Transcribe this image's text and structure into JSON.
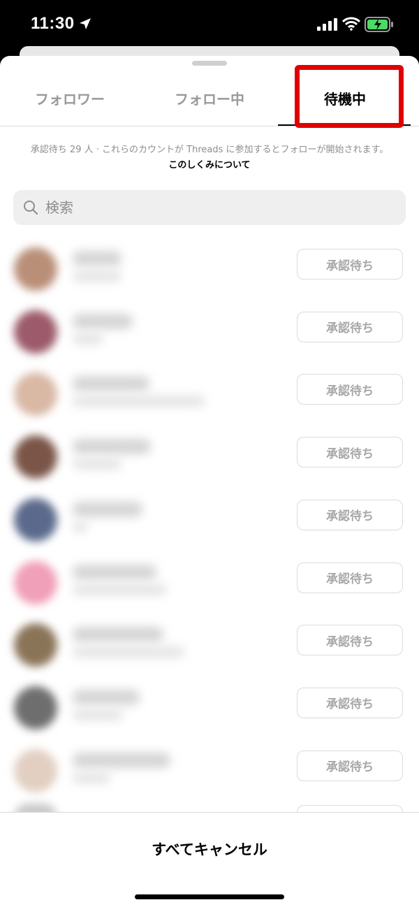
{
  "status_bar": {
    "time": "11:30"
  },
  "tabs": [
    {
      "label": "フォロワー",
      "active": false
    },
    {
      "label": "フォロー中",
      "active": false
    },
    {
      "label": "待機中",
      "active": true
    }
  ],
  "info": {
    "text": "承認待ち 29 人 · これらのカウントが Threads に参加するとフォローが開始されます。",
    "link": "このしくみについて"
  },
  "search": {
    "placeholder": "検索"
  },
  "rows": [
    {
      "avatar_color": "#b98f78",
      "button_label": "承認待ち"
    },
    {
      "avatar_color": "#9c5a6a",
      "button_label": "承認待ち"
    },
    {
      "avatar_color": "#d9b8a4",
      "button_label": "承認待ち"
    },
    {
      "avatar_color": "#7a5548",
      "button_label": "承認待ち"
    },
    {
      "avatar_color": "#5b6a8c",
      "button_label": "承認待ち"
    },
    {
      "avatar_color": "#f0a0b8",
      "button_label": "承認待ち"
    },
    {
      "avatar_color": "#8a7458",
      "button_label": "承認待ち"
    },
    {
      "avatar_color": "#6e6e6e",
      "button_label": "承認待ち"
    },
    {
      "avatar_color": "#e2cfc2",
      "button_label": "承認待ち"
    }
  ],
  "footer": {
    "cancel_all_label": "すべてキャンセル"
  },
  "colors": {
    "highlight": "#e00000",
    "button_text": "#a8a8a8",
    "link": "#000000"
  }
}
